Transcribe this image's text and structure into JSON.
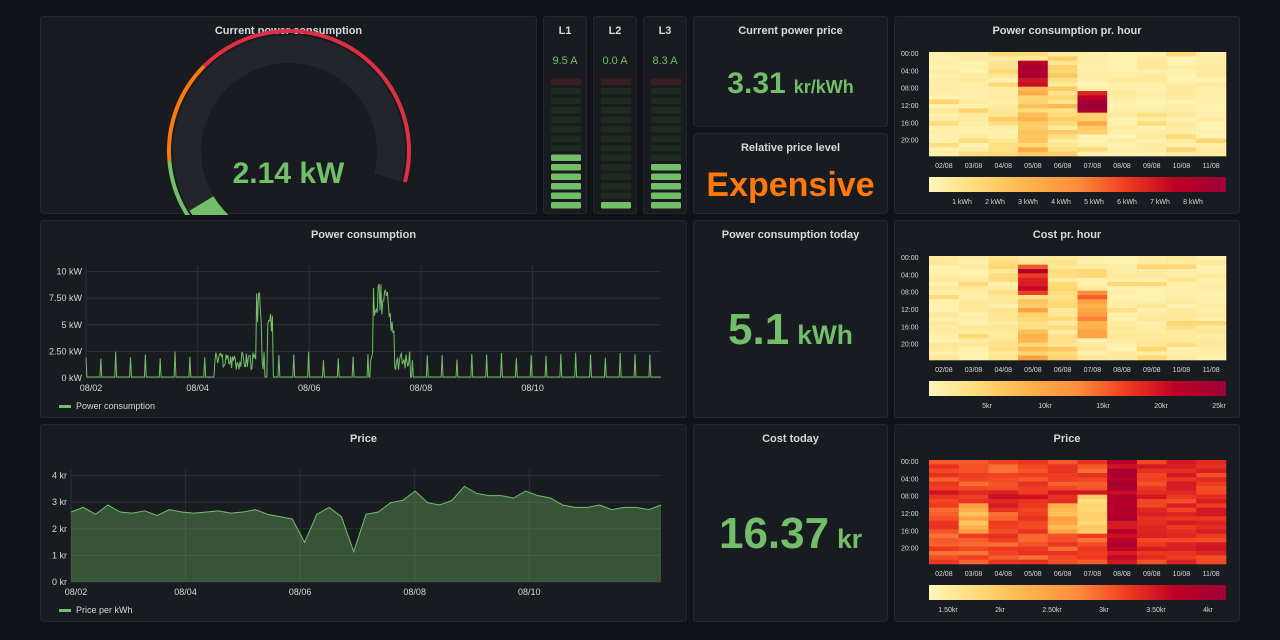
{
  "colors": {
    "green": "#73bf69",
    "orange": "#ff780a",
    "red": "#e02f44",
    "dark_green": "#37872d"
  },
  "current_power": {
    "title": "Current power consumption",
    "value": "2.14",
    "unit": "kW",
    "level_fraction": 0.214,
    "thresholds": [
      "green",
      "orange",
      "red"
    ]
  },
  "phases": [
    {
      "label": "L1",
      "value": "9.5 A",
      "lit_segments": 6
    },
    {
      "label": "L2",
      "value": "0.0 A",
      "lit_segments": 1
    },
    {
      "label": "L3",
      "value": "8.3 A",
      "lit_segments": 5
    }
  ],
  "price_now": {
    "title": "Current power price",
    "value": "3.31",
    "unit": "kr/kWh"
  },
  "price_level": {
    "title": "Relative price level",
    "value": "Expensive"
  },
  "energy_today": {
    "title": "Power consumption today",
    "value": "5.1",
    "unit": "kWh"
  },
  "cost_today": {
    "title": "Cost today",
    "value": "16.37",
    "unit": "kr"
  },
  "heatmap_consumption": {
    "title": "Power consumption pr. hour",
    "y_labels": [
      "00:00",
      "04:00",
      "08:00",
      "12:00",
      "16:00",
      "20:00"
    ],
    "x_labels": [
      "02/08",
      "03/08",
      "04/08",
      "05/08",
      "06/08",
      "07/08",
      "08/08",
      "09/08",
      "10/08",
      "11/08"
    ],
    "legend_labels": [
      "1 kWh",
      "2 kWh",
      "3 kWh",
      "4 kWh",
      "5 kWh",
      "6 kWh",
      "7 kWh",
      "8 kWh"
    ],
    "palette": [
      "#fff7bc",
      "#feda76",
      "#feb24c",
      "#fd8d3c",
      "#f03b20",
      "#bd0026",
      "#9e0038"
    ]
  },
  "heatmap_cost": {
    "title": "Cost pr. hour",
    "y_labels": [
      "00:00",
      "04:00",
      "08:00",
      "12:00",
      "16:00",
      "20:00"
    ],
    "x_labels": [
      "02/08",
      "03/08",
      "04/08",
      "05/08",
      "06/08",
      "07/08",
      "08/08",
      "09/08",
      "10/08",
      "11/08"
    ],
    "legend_labels": [
      "5kr",
      "10kr",
      "15kr",
      "20kr",
      "25kr"
    ]
  },
  "heatmap_price": {
    "title": "Price",
    "y_labels": [
      "00:00",
      "04:00",
      "08:00",
      "12:00",
      "16:00",
      "20:00"
    ],
    "x_labels": [
      "02/08",
      "03/08",
      "04/08",
      "05/08",
      "06/08",
      "07/08",
      "08/08",
      "09/08",
      "10/08",
      "11/08"
    ],
    "legend_labels": [
      "1.50kr",
      "2kr",
      "2.50kr",
      "3kr",
      "3.50kr",
      "4kr"
    ]
  },
  "chart_data": [
    {
      "type": "line",
      "title": "Power consumption",
      "series": [
        {
          "name": "Power consumption",
          "color": "#73bf69"
        }
      ],
      "y_ticks": [
        "0 kW",
        "2.50 kW",
        "5 kW",
        "7.50 kW",
        "10 kW"
      ],
      "x_ticks": [
        "08/02",
        "08/04",
        "08/06",
        "08/08",
        "08/10"
      ],
      "ylim": [
        0,
        11
      ],
      "baseline_kw": 0.1,
      "spike_kw": 2.4,
      "events": [
        {
          "day": 3.1,
          "width": 0.05,
          "kw": 8.5
        },
        {
          "day": 3.3,
          "width": 0.05,
          "kw": 6.6
        },
        {
          "day": 5.3,
          "width": 0.15,
          "kw": 9.5
        },
        {
          "day": 5.45,
          "width": 0.08,
          "kw": 7.2
        }
      ]
    },
    {
      "type": "area",
      "title": "Price",
      "series": [
        {
          "name": "Price per kWh",
          "color": "#73bf69"
        }
      ],
      "y_ticks": [
        "0 kr",
        "1 kr",
        "2 kr",
        "3 kr",
        "4 kr"
      ],
      "x_ticks": [
        "08/02",
        "08/04",
        "08/06",
        "08/08",
        "08/10"
      ],
      "ylim": [
        0,
        4.8
      ],
      "values": [
        3.0,
        3.2,
        2.9,
        3.3,
        3.0,
        2.95,
        3.05,
        2.85,
        3.1,
        3.0,
        2.95,
        3.0,
        3.05,
        2.95,
        3.0,
        3.1,
        2.9,
        2.8,
        2.7,
        1.7,
        2.9,
        3.2,
        2.8,
        1.3,
        2.9,
        3.0,
        3.4,
        3.5,
        3.9,
        3.4,
        3.3,
        3.5,
        4.1,
        3.8,
        3.7,
        3.7,
        3.6,
        3.9,
        3.7,
        3.6,
        3.3,
        3.2,
        3.2,
        3.3,
        3.1,
        3.2,
        3.2,
        3.1,
        3.3
      ]
    }
  ]
}
